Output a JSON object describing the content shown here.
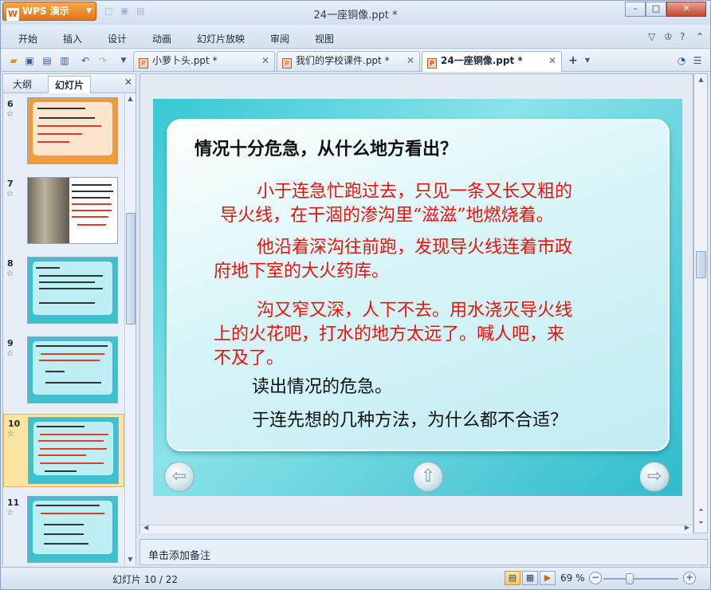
{
  "app": {
    "name": "WPS 演示",
    "window_title": "24一座铜像.ppt *"
  },
  "window_controls": {
    "minimize": "–",
    "maximize": "□",
    "close": "✕"
  },
  "menu": [
    "开始",
    "插入",
    "设计",
    "动画",
    "幻灯片放映",
    "审阅",
    "视图"
  ],
  "tabs": [
    {
      "label": "小萝卜头.ppt *",
      "close": "✕"
    },
    {
      "label": "我们的学校课件.ppt *",
      "close": "✕"
    },
    {
      "label": "24一座铜像.ppt *",
      "close": "✕"
    }
  ],
  "left_panel": {
    "tabs": [
      "大纲",
      "幻灯片"
    ],
    "active_tab": "幻灯片",
    "close": "✕",
    "slides": [
      {
        "num": "6",
        "style": "orange",
        "selected": false
      },
      {
        "num": "7",
        "style": "photo",
        "selected": false
      },
      {
        "num": "8",
        "style": "cyan",
        "selected": false
      },
      {
        "num": "9",
        "style": "cyan",
        "selected": false
      },
      {
        "num": "10",
        "style": "cyan",
        "selected": true
      },
      {
        "num": "11",
        "style": "cyan",
        "selected": false
      }
    ]
  },
  "slide": {
    "heading": "情况十分危急，从什么地方看出？",
    "para1_line1": "小于连急忙跑过去，只见一条又长又粗的",
    "para1_line2": "导火线，在干涸的渗沟里“滋滋”地燃烧着。",
    "para2_line1": "他沿着深沟往前跑，发现导火线连着市政",
    "para2_line2": "府地下室的大火药库。",
    "para3_line1": "沟又窄又深，人下不去。用水浇灭导火线",
    "para3_line2": "上的火花吧，打水的地方太远了。喊人吧，来",
    "para3_line3": "不及了。",
    "line_a": "读出情况的危急。",
    "line_b": "于连先想的几种方法，为什么都不合适？",
    "nav": {
      "prev": "⇦",
      "home": "⇧",
      "next": "⇨"
    }
  },
  "notes": {
    "placeholder": "单击添加备注"
  },
  "status": {
    "slide_counter": "幻灯片 10 / 22",
    "zoom": "69 %",
    "zoom_minus": "−",
    "zoom_plus": "+"
  },
  "colors": {
    "slide_red_text": "#e8120c",
    "slide_bg": "#36c8d4",
    "accent_orange": "#e0741a"
  }
}
